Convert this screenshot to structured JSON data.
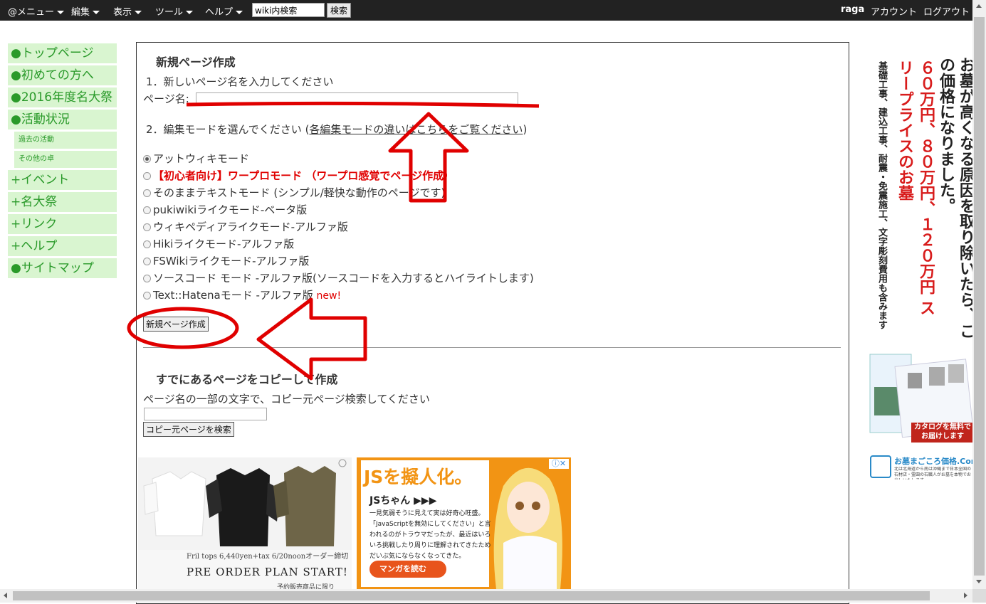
{
  "menubar": {
    "menu_at": "@メニュー",
    "menu_edit": "編集",
    "menu_view": "表示",
    "menu_tools": "ツール",
    "menu_help": "ヘルプ",
    "search_value": "wiki内検索",
    "search_button": "検索",
    "user": "raga",
    "account": "アカウント",
    "logout": "ログアウト"
  },
  "sidebar": {
    "items": [
      {
        "label": "●トップページ"
      },
      {
        "label": "●初めての方へ"
      },
      {
        "label": "●2016年度名大祭"
      },
      {
        "label": "●活動状況"
      },
      {
        "label": "過去の活動"
      },
      {
        "label": "その他の卓"
      },
      {
        "label": "+イベント"
      },
      {
        "label": "+名大祭"
      },
      {
        "label": "+リンク"
      },
      {
        "label": "+ヘルプ"
      },
      {
        "label": "●サイトマップ"
      }
    ]
  },
  "new_page": {
    "heading": "新規ページ作成",
    "step1": "1．新しいページ名を入力してください",
    "page_name_label": "ページ名:",
    "page_name_value": "",
    "step2_prefix": "2．編集モードを選んでください (",
    "step2_link": "各編集モードの違いはこちらをご覧ください",
    "step2_suffix": ")",
    "modes": [
      {
        "label": "アットウィキモード",
        "checked": true
      },
      {
        "label": "【初心者向け】ワープロモード （ワープロ感覚でページ作成）",
        "checked": false
      },
      {
        "label": "そのままテキストモード (シンプル/軽快な動作のページです)",
        "checked": false
      },
      {
        "label": "pukiwikiライクモード-ベータ版",
        "checked": false
      },
      {
        "label": "ウィキペディアライクモード-アルファ版",
        "checked": false
      },
      {
        "label": "Hikiライクモード-アルファ版",
        "checked": false
      },
      {
        "label": "FSWikiライクモード-アルファ版",
        "checked": false
      },
      {
        "label": "ソースコード モード -アルファ版(ソースコードを入力するとハイライトします)",
        "checked": false
      },
      {
        "label": "Text::Hatenaモード -アルファ版",
        "checked": false
      }
    ],
    "new_badge": "new!",
    "create_button": "新規ページ作成"
  },
  "copy_page": {
    "heading": "すでにあるページをコピーして作成",
    "instruction": "ページ名の一部の文字で、コピー元ページ検索してください",
    "search_value": "",
    "search_button": "コピー元ページを検索"
  },
  "ads": {
    "tops_caption": "Fril tops 6,440yen+tax 6/20noonオーダー締切",
    "tops_headline": "PRE ORDER PLAN START!",
    "tops_footer": "予約販売商品に限り",
    "js_title": "JSを擬人化。",
    "js_name": "JSちゃん ▶▶▶",
    "js_desc": "一見気弱そうに見えて実は好奇心旺盛。「JavaScriptを無効にしてください」と言われるのがトラウマだったが、最近はいろいろ挑戦したり周りに理解されてきたためだいぶ気にならなくなってきた。",
    "js_button": "マンガを読む",
    "side_headline": "お墓が高くなる原因を取り除いたら、この価格になりました。",
    "side_price": "６０万円、８０万円、１２０万円 スリープライスのお墓",
    "side_desc": "基礎工事、建込工事、耐震・免震施工、文字彫刻費用も含みます",
    "side_catalog": "カタログを無料でお届けします",
    "side_logo": "お墓まごころ価格.Com",
    "side_logo_sub": "北は北海道から南は沖縄まで日本全国の石材店・霊園の石職人がお墓を本物でお出しいたします"
  },
  "colors": {
    "topbar": "#222222",
    "sidebar_bg": "#d9f5d0",
    "sidebar_text": "#2a9a2a",
    "highlight_red": "#e00000",
    "ad_orange": "#f29414"
  }
}
